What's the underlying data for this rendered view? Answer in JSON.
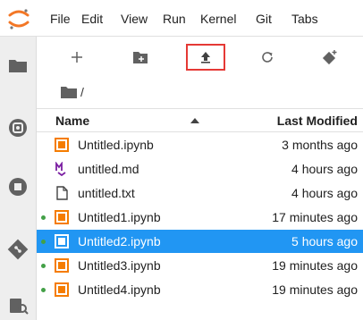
{
  "menu": [
    "File",
    "Edit",
    "View",
    "Run",
    "Kernel",
    "Git",
    "Tabs"
  ],
  "breadcrumb": {
    "separator": "/"
  },
  "header": {
    "name": "Name",
    "last_modified": "Last Modified"
  },
  "files": [
    {
      "name": "Untitled.ipynb",
      "modified": "3 months ago",
      "type": "notebook",
      "running": false,
      "selected": false
    },
    {
      "name": "untitled.md",
      "modified": "4 hours ago",
      "type": "markdown",
      "running": false,
      "selected": false
    },
    {
      "name": "untitled.txt",
      "modified": "4 hours ago",
      "type": "text",
      "running": false,
      "selected": false
    },
    {
      "name": "Untitled1.ipynb",
      "modified": "17 minutes ago",
      "type": "notebook",
      "running": true,
      "selected": false
    },
    {
      "name": "Untitled2.ipynb",
      "modified": "5 hours ago",
      "type": "notebook",
      "running": true,
      "selected": true
    },
    {
      "name": "Untitled3.ipynb",
      "modified": "19 minutes ago",
      "type": "notebook",
      "running": true,
      "selected": false
    },
    {
      "name": "Untitled4.ipynb",
      "modified": "19 minutes ago",
      "type": "notebook",
      "running": true,
      "selected": false
    }
  ],
  "colors": {
    "selected_row": "#2196f3",
    "upload_highlight": "#e53935",
    "notebook_icon": "#f57c00",
    "markdown_icon": "#7b1fa2",
    "running_dot": "#43a047"
  }
}
